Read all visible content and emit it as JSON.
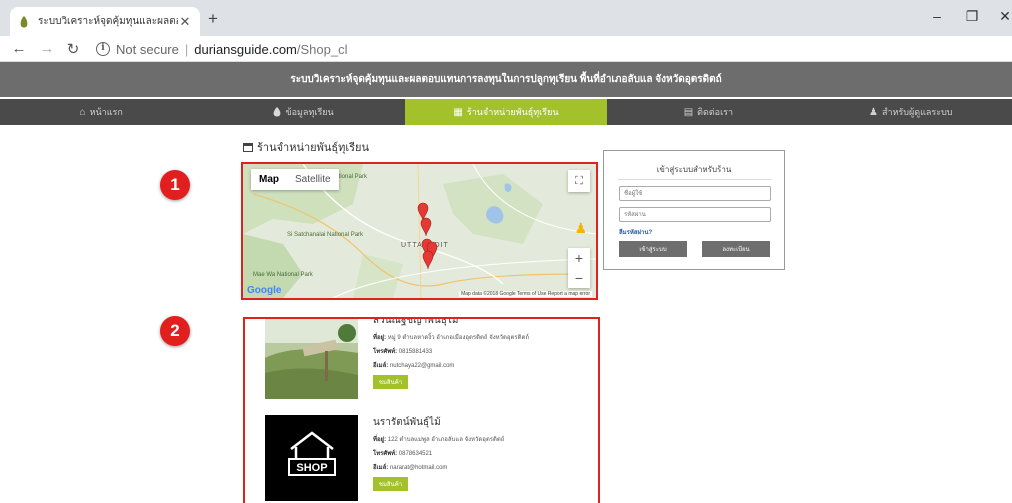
{
  "browser": {
    "tab_title": "ระบบวิเคราะห์จุดคุ้มทุนและผลตอบแทน",
    "tab_close": "✕",
    "new_tab": "+",
    "window_controls": {
      "minimize": "–",
      "restore": "❐",
      "close": "✕"
    },
    "not_secure": "Not secure",
    "separator": "|",
    "domain": "duriansguide.com",
    "path": "/Shop_cl",
    "icons": [
      "back-icon",
      "forward-icon",
      "reload-icon",
      "info-icon",
      "translate-icon",
      "zoom-icon",
      "star-icon",
      "avatar",
      "menu-icon"
    ]
  },
  "site": {
    "title": "ระบบวิเคราะห์จุดคุ้มทุนและผลตอบแทนการลงทุนในการปลูกทุเรียน พื้นที่อำเภอลับแล จังหวัดอุตรดิตถ์"
  },
  "nav": {
    "items": [
      {
        "label": "หน้าแรก",
        "icon": "home-icon"
      },
      {
        "label": "ข้อมูลทุเรียน",
        "icon": "durian-icon"
      },
      {
        "label": "ร้านจำหน่ายพันธุ์ทุเรียน",
        "icon": "store-icon",
        "active": true
      },
      {
        "label": "ติดต่อเรา",
        "icon": "contact-card-icon"
      },
      {
        "label": "สำหรับผู้ดูแลระบบ",
        "icon": "admin-icon"
      }
    ]
  },
  "section": {
    "title": "ร้านจำหน่ายพันธุ์ทุเรียน"
  },
  "badges": {
    "one": "1",
    "two": "2"
  },
  "map": {
    "type_map": "Map",
    "type_satellite": "Satellite",
    "fullscreen": "⛶",
    "zoom_in": "+",
    "zoom_out": "−",
    "google": "Google",
    "attribution": "Map data ©2018 Google   Terms of Use   Report a map error",
    "labels": {
      "park_a": "Si Satchanalai National Park",
      "park_b": "Mae Wa National Park",
      "city": "UTTARADIT",
      "park_c": "National Park"
    },
    "marker_count": 5
  },
  "login": {
    "title": "เข้าสู่ระบบสำหรับร้าน",
    "username_placeholder": "ชื่อผู้ใช้",
    "password_placeholder": "รหัสผ่าน",
    "forgot": "ลืมรหัสผ่าน?",
    "login_btn": "เข้าสู่ระบบ",
    "register_btn": "ลงทะเบียน"
  },
  "shops": [
    {
      "name": "สวนณัฐชญาพันธุ์ไม้",
      "address_label": "ที่อยู่:",
      "address": "หมู่ 9 ตำบลหาดงิ้ว อำเภอเมืองอุตรดิตถ์ จังหวัดอุตรดิตถ์",
      "phone_label": "โทรศัพท์:",
      "phone": "0815881433",
      "email_label": "อีเมล์:",
      "email": "nutchaya22@gmail.com",
      "button": "ชมสินค้า"
    },
    {
      "name": "นรารัตน์พันธุ์ไม้",
      "address_label": "ที่อยู่:",
      "address": "122 ตำบลแม่พูล อำเภอลับแล จังหวัดอุตรดิตถ์",
      "phone_label": "โทรศัพท์:",
      "phone": "0878634521",
      "email_label": "อีเมล์:",
      "email": "nararat@hotmail.com",
      "button": "ชมสินค้า",
      "image_text": "SHOP"
    }
  ]
}
